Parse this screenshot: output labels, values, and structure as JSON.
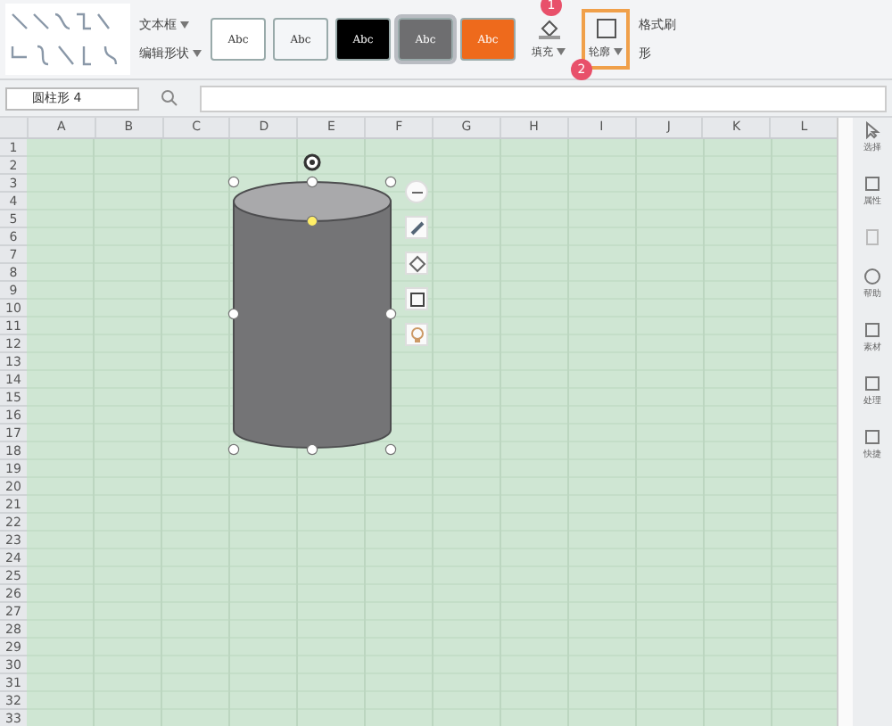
{
  "ribbon": {
    "text_box": "文本框",
    "edit_shape": "编辑形状",
    "swatches": [
      {
        "label": "Abc",
        "color": "#ffffff",
        "selected": false
      },
      {
        "label": "Abc",
        "color": "#f4f6f8",
        "selected": false
      },
      {
        "label": "Abc",
        "color": "#000000",
        "selected": false
      },
      {
        "label": "Abc",
        "color": "#6e6e70",
        "selected": true
      },
      {
        "label": "Abc",
        "color": "#ee6a1c",
        "selected": false
      }
    ],
    "tools": [
      {
        "kind": "fill",
        "label": "填充",
        "highlighted": false
      },
      {
        "kind": "outline",
        "label": "轮廓",
        "highlighted": true
      }
    ],
    "format_painter": "格式刷",
    "shape_partial": "形",
    "step_badges": [
      "1",
      "2"
    ]
  },
  "name_box": "圆柱形 4",
  "columns": [
    "A",
    "B",
    "C",
    "D",
    "E",
    "F",
    "G",
    "H",
    "I",
    "J",
    "K",
    "L"
  ],
  "rows": [
    "1",
    "2",
    "3",
    "4",
    "5",
    "6",
    "7",
    "8",
    "9",
    "10",
    "11",
    "12",
    "13",
    "14",
    "15",
    "16",
    "17",
    "18",
    "19",
    "20",
    "21",
    "22",
    "23",
    "24",
    "25",
    "26",
    "27",
    "28",
    "29",
    "30",
    "31",
    "32",
    "33"
  ],
  "sidebar": [
    {
      "kind": "select",
      "label": "选择"
    },
    {
      "kind": "properties",
      "label": "属性"
    },
    {
      "kind": "blank"
    },
    {
      "kind": "help",
      "label": "帮助"
    },
    {
      "kind": "assets",
      "label": "素材"
    },
    {
      "kind": "process",
      "label": "处理"
    },
    {
      "kind": "quick",
      "label": "快捷"
    }
  ]
}
